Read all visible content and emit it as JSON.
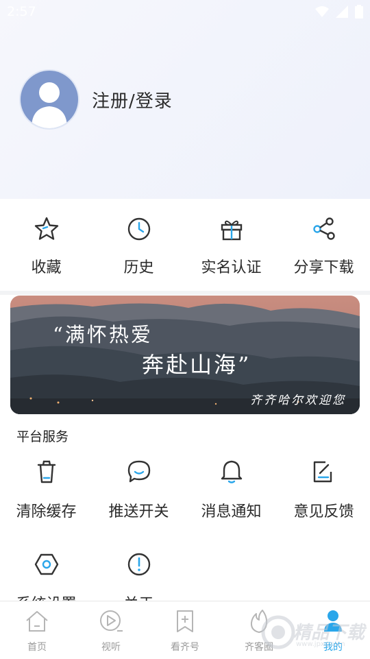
{
  "status_bar": {
    "time": "2:57"
  },
  "profile": {
    "login_label": "注册/登录"
  },
  "quick_actions": [
    {
      "label": "收藏",
      "icon": "star-icon"
    },
    {
      "label": "历史",
      "icon": "clock-icon"
    },
    {
      "label": "实名认证",
      "icon": "gift-icon"
    },
    {
      "label": "分享下载",
      "icon": "share-icon"
    }
  ],
  "banner": {
    "line1": "“满怀热爱",
    "line2": "奔赴山海”",
    "line3": "齐齐哈尔欢迎您"
  },
  "services": {
    "title": "平台服务",
    "items": [
      {
        "label": "清除缓存",
        "icon": "trash-icon"
      },
      {
        "label": "推送开关",
        "icon": "chat-bubble-icon"
      },
      {
        "label": "消息通知",
        "icon": "bell-icon"
      },
      {
        "label": "意见反馈",
        "icon": "edit-icon"
      },
      {
        "label": "系统设置",
        "icon": "hexagon-settings-icon"
      },
      {
        "label": "关于",
        "icon": "info-icon"
      }
    ]
  },
  "tabbar": {
    "tabs": [
      {
        "label": "首页",
        "icon": "home-icon"
      },
      {
        "label": "视听",
        "icon": "play-icon"
      },
      {
        "label": "看齐号",
        "icon": "bookmark-plus-icon"
      },
      {
        "label": "齐客圈",
        "icon": "flame-icon"
      },
      {
        "label": "我的",
        "icon": "user-icon",
        "active": true
      }
    ]
  },
  "watermark": {
    "text": "精品下载",
    "sub": "www.jpxz.com"
  },
  "colors": {
    "accent": "#2aa6ea",
    "icon_stroke": "#333333",
    "avatar_bg": "#7f98cc"
  }
}
